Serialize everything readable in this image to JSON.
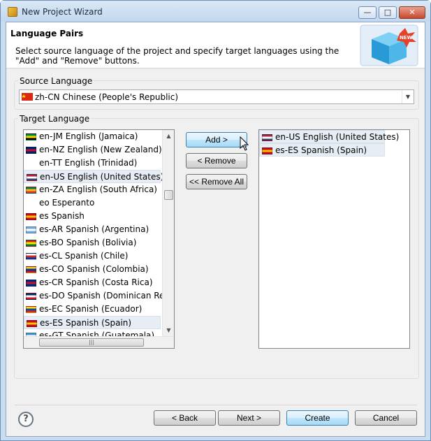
{
  "window": {
    "title": "New Project Wizard",
    "minimize": "—",
    "maximize": "□",
    "close": "✕"
  },
  "banner": {
    "title": "Language Pairs",
    "description": "Select source language of the project and specify target languages using the \"Add\" and \"Remove\" buttons.",
    "image_icon": "new-project-box-icon",
    "badge": "NEW"
  },
  "source": {
    "group_label": "Source Language",
    "selected": "zh-CN Chinese (People's Republic)",
    "flag_colors": [
      "#de2910",
      "#ffde00"
    ]
  },
  "target": {
    "group_label": "Target Language",
    "available": [
      {
        "label": "en-JM English (Jamaica)",
        "flag": [
          "#009b3a",
          "#fed100",
          "#000000"
        ]
      },
      {
        "label": "en-NZ English (New Zealand)",
        "flag": [
          "#012169",
          "#c8102e",
          "#012169"
        ]
      },
      {
        "label": "en-TT English (Trinidad)",
        "flag": null
      },
      {
        "label": "en-US English (United States)",
        "flag": [
          "#b22234",
          "#ffffff",
          "#3c3b6e"
        ],
        "selected": true
      },
      {
        "label": "en-ZA English (South Africa)",
        "flag": [
          "#007a4d",
          "#ffb612",
          "#de3831"
        ]
      },
      {
        "label": "eo Esperanto",
        "flag": null
      },
      {
        "label": "es Spanish",
        "flag": [
          "#c60b1e",
          "#ffc400",
          "#c60b1e"
        ]
      },
      {
        "label": "es-AR Spanish (Argentina)",
        "flag": [
          "#74acdf",
          "#ffffff",
          "#74acdf"
        ]
      },
      {
        "label": "es-BO Spanish (Bolivia)",
        "flag": [
          "#d52b1e",
          "#f9e300",
          "#007934"
        ]
      },
      {
        "label": "es-CL Spanish (Chile)",
        "flag": [
          "#ffffff",
          "#d52b1e",
          "#0039a6"
        ]
      },
      {
        "label": "es-CO Spanish (Colombia)",
        "flag": [
          "#fcd116",
          "#003893",
          "#ce1126"
        ]
      },
      {
        "label": "es-CR Spanish (Costa Rica)",
        "flag": [
          "#002b7f",
          "#ce1126",
          "#002b7f"
        ]
      },
      {
        "label": "es-DO Spanish (Dominican Republic)",
        "flag": [
          "#002d62",
          "#ffffff",
          "#ce1126"
        ]
      },
      {
        "label": "es-EC Spanish (Ecuador)",
        "flag": [
          "#ffdd00",
          "#034ea2",
          "#ed1c24"
        ]
      },
      {
        "label": "es-ES Spanish (Spain)",
        "flag": [
          "#c60b1e",
          "#ffc400",
          "#c60b1e"
        ],
        "selected": true
      },
      {
        "label": "es-GT Spanish (Guatemala)",
        "flag": [
          "#4997d0",
          "#ffffff",
          "#4997d0"
        ]
      }
    ],
    "chosen": [
      {
        "label": "en-US English (United States)",
        "flag": [
          "#b22234",
          "#ffffff",
          "#3c3b6e"
        ]
      },
      {
        "label": "es-ES Spanish (Spain)",
        "flag": [
          "#c60b1e",
          "#ffc400",
          "#c60b1e"
        ]
      }
    ]
  },
  "actions": {
    "add": "Add >",
    "remove": "< Remove",
    "remove_all": "<< Remove All"
  },
  "footer": {
    "help": "?",
    "back": "< Back",
    "next": "Next >",
    "create": "Create",
    "cancel": "Cancel"
  },
  "colors": {
    "accent": "#3c7fb1",
    "selection": "#e7edf4",
    "window_frame": "#c9dcf0"
  }
}
